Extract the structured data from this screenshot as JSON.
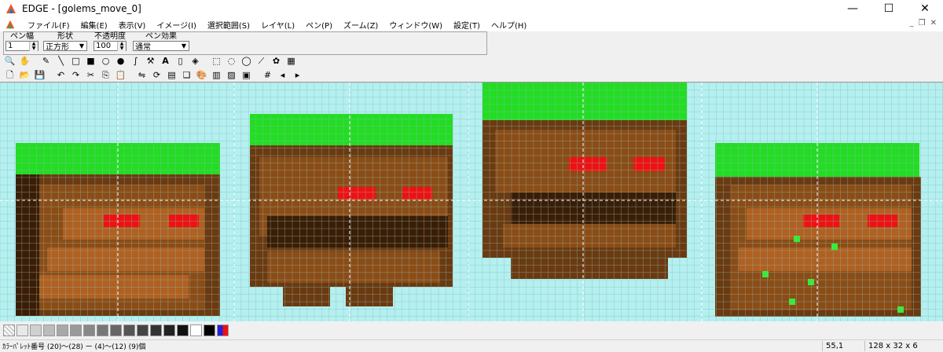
{
  "window": {
    "title": "EDGE - [golems_move_0]"
  },
  "window_buttons": {
    "minimize": "—",
    "maximize": "☐",
    "close": "✕"
  },
  "menu": [
    "ファイル(F)",
    "編集(E)",
    "表示(V)",
    "イメージ(I)",
    "選択範囲(S)",
    "レイヤ(L)",
    "ペン(P)",
    "ズーム(Z)",
    "ウィンドウ(W)",
    "設定(T)",
    "ヘルプ(H)"
  ],
  "mdi_buttons": {
    "minimize": "_",
    "restore": "❐",
    "close": "✕"
  },
  "penbar": {
    "width_label": "ペン幅",
    "width_value": "1",
    "shape_label": "形状",
    "shape_value": "正方形",
    "opacity_label": "不透明度",
    "opacity_value": "100",
    "effect_label": "ペン効果",
    "effect_value": "通常"
  },
  "tools_row1": [
    "zoom-icon",
    "hand-icon",
    "pencil-icon",
    "line-icon",
    "rect-icon",
    "circle-icon",
    "filled-circle-icon",
    "curve-icon",
    "hammer-icon",
    "text-icon",
    "eraser-icon",
    "fill-icon",
    "select-rect-icon",
    "select-circle-icon",
    "lasso-icon",
    "magic-wand-icon",
    "stamp-icon",
    "select-grid-icon"
  ],
  "tools_row2": [
    "new-icon",
    "open-icon",
    "save-icon",
    "undo-icon",
    "redo-icon",
    "cut-icon",
    "copy-icon",
    "paste-icon",
    "flip-icon",
    "rotate-icon",
    "palette-edit-icon",
    "layer-icon",
    "color-icon",
    "film-icon",
    "image-icon",
    "frame-icon",
    "grid-icon",
    "prev-icon",
    "next-icon"
  ],
  "status": {
    "left": "ｶﾗｰﾊﾟﾚｯﾄ番号 (20)〜(28) ー (4)〜(12) (9)個",
    "coords": "55,1",
    "size": "128 x 32 x 6"
  },
  "colors": {
    "grass": "#22dd22",
    "grass_light": "#bbeebb",
    "dirt": "#6b3a10",
    "dirt_dark": "#3b1d05",
    "dirt_mid": "#8b4c15",
    "dirt_light": "#b06020",
    "eye": "#ee1111",
    "bg": "#b4f0f0",
    "speck": "#33ee33"
  }
}
